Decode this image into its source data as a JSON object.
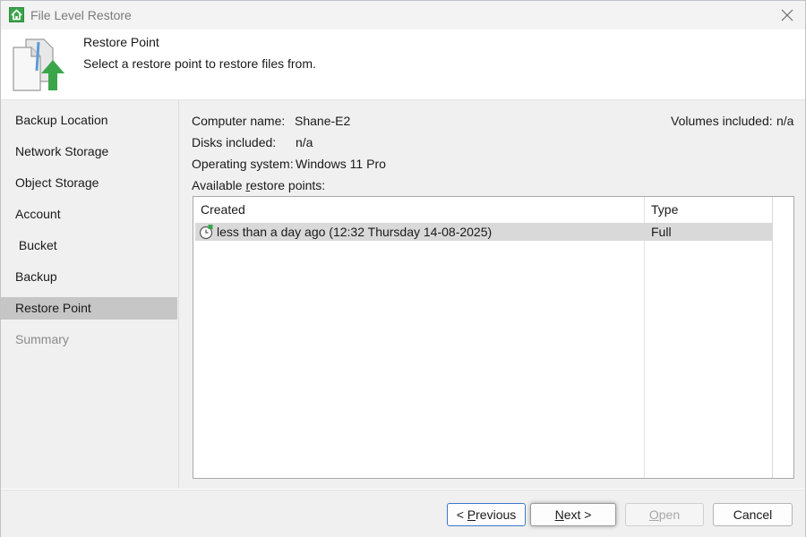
{
  "window": {
    "title": "File Level Restore",
    "app_icon": "home-icon",
    "close_icon": "close-icon"
  },
  "header": {
    "title": "Restore Point",
    "subtitle": "Select a restore point to restore files from.",
    "icon": "restore-document-icon"
  },
  "sidebar": {
    "items": [
      {
        "label": "Backup Location",
        "state": "normal"
      },
      {
        "label": "Network Storage",
        "state": "normal"
      },
      {
        "label": "Object Storage",
        "state": "normal"
      },
      {
        "label": "Account",
        "state": "normal"
      },
      {
        "label": " Bucket",
        "state": "normal"
      },
      {
        "label": "Backup",
        "state": "normal"
      },
      {
        "label": "Restore Point",
        "state": "active"
      },
      {
        "label": "Summary",
        "state": "disabled"
      }
    ]
  },
  "info": {
    "computer_name_label": "Computer name:",
    "computer_name_value": "Shane-E2",
    "disks_label": "Disks included:",
    "disks_value": "n/a",
    "os_label": "Operating system:",
    "os_value": "Windows 11 Pro",
    "volumes_label": "Volumes included:",
    "volumes_value": "n/a"
  },
  "restore_points": {
    "label_pre": "Available ",
    "label_accel": "r",
    "label_post": "estore points:",
    "columns": {
      "created": "Created",
      "type": "Type"
    },
    "rows": [
      {
        "created": "less than a day ago (12:32 Thursday 14-08-2025)",
        "type": "Full",
        "icon": "clock-icon",
        "selected": true
      }
    ]
  },
  "buttons": {
    "previous": {
      "pre": "< ",
      "accel": "P",
      "post": "revious"
    },
    "next": {
      "pre": "",
      "accel": "N",
      "post": "ext >"
    },
    "open": {
      "pre": "",
      "accel": "O",
      "post": "pen",
      "enabled": false
    },
    "cancel": {
      "label": "Cancel"
    }
  },
  "colors": {
    "accent": "#3b78c9",
    "active_nav": "#c6c6c6",
    "icon_green": "#3aa54a"
  }
}
